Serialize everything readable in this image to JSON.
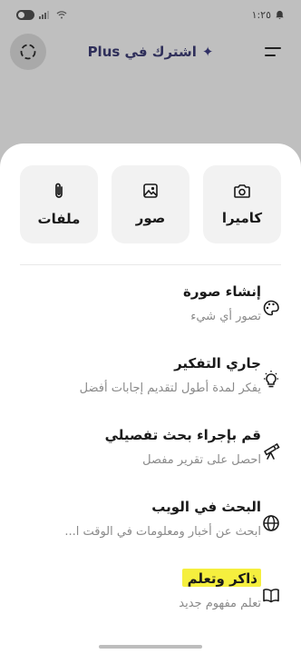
{
  "status_bar": {
    "time": "١:٢٥"
  },
  "header": {
    "upgrade_label": "اشترك في Plus",
    "sparkle": "✦",
    "menu_icon": "menu-icon",
    "new_chat_icon": "dashed-circle-icon"
  },
  "attachments": [
    {
      "label": "كاميرا",
      "icon": "camera-icon"
    },
    {
      "label": "صور",
      "icon": "image-icon"
    },
    {
      "label": "ملفات",
      "icon": "paperclip-icon"
    }
  ],
  "menu": [
    {
      "title": "إنشاء صورة",
      "subtitle": "تصور أي شيء",
      "icon": "palette-icon"
    },
    {
      "title": "جاري التفكير",
      "subtitle": "يفكر لمدة أطول لتقديم إجابات أفضل",
      "icon": "lightbulb-icon"
    },
    {
      "title": "قم بإجراء بحث تفصيلي",
      "subtitle": "احصل على تقرير مفصل",
      "icon": "telescope-icon"
    },
    {
      "title": "البحث في الويب",
      "subtitle": "ابحث عن أخبار ومعلومات في الوقت ا...",
      "icon": "globe-icon"
    },
    {
      "title": "ذاكر وتعلم",
      "subtitle": "تعلم مفهوم جديد",
      "icon": "book-icon"
    }
  ],
  "colors": {
    "dimmed_background": "#bfbfbf",
    "sheet": "#ffffff",
    "tile": "#f2f2f2",
    "highlight": "#f5ef3e",
    "upgrade_text": "#2f2f5a"
  }
}
